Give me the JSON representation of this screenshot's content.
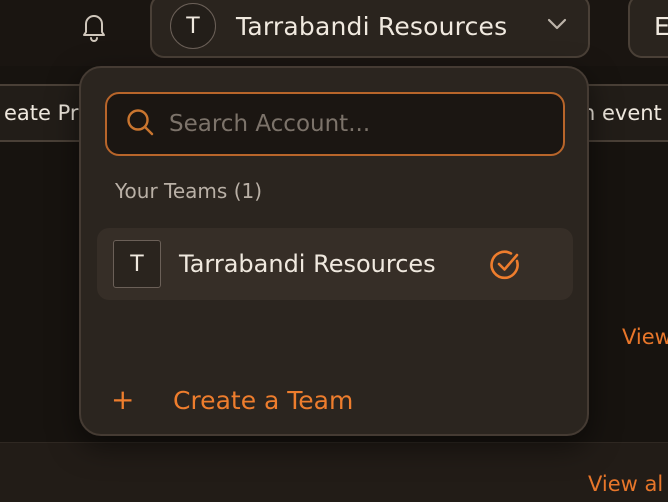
{
  "header": {
    "team_initial": "T",
    "team_name": "Tarrabandi Resources",
    "right_initial": "E"
  },
  "background": {
    "left_pill_text": "eate Pr",
    "right_pill_text": "n event",
    "view_link_1": "View",
    "view_link_2": "View al"
  },
  "dropdown": {
    "search_placeholder": "Search Account...",
    "section_label": "Your Teams (1)",
    "teams": [
      {
        "initial": "T",
        "name": "Tarrabandi Resources",
        "selected": true
      }
    ],
    "create_label": "Create a Team"
  },
  "colors": {
    "accent": "#ee7d2d",
    "background": "#17130f",
    "panel": "#2b251f"
  },
  "icons": {
    "bell": "bell-icon",
    "chevron": "chevron-down-icon",
    "search": "search-icon",
    "check": "check-circle-icon",
    "plus": "plus-icon"
  }
}
